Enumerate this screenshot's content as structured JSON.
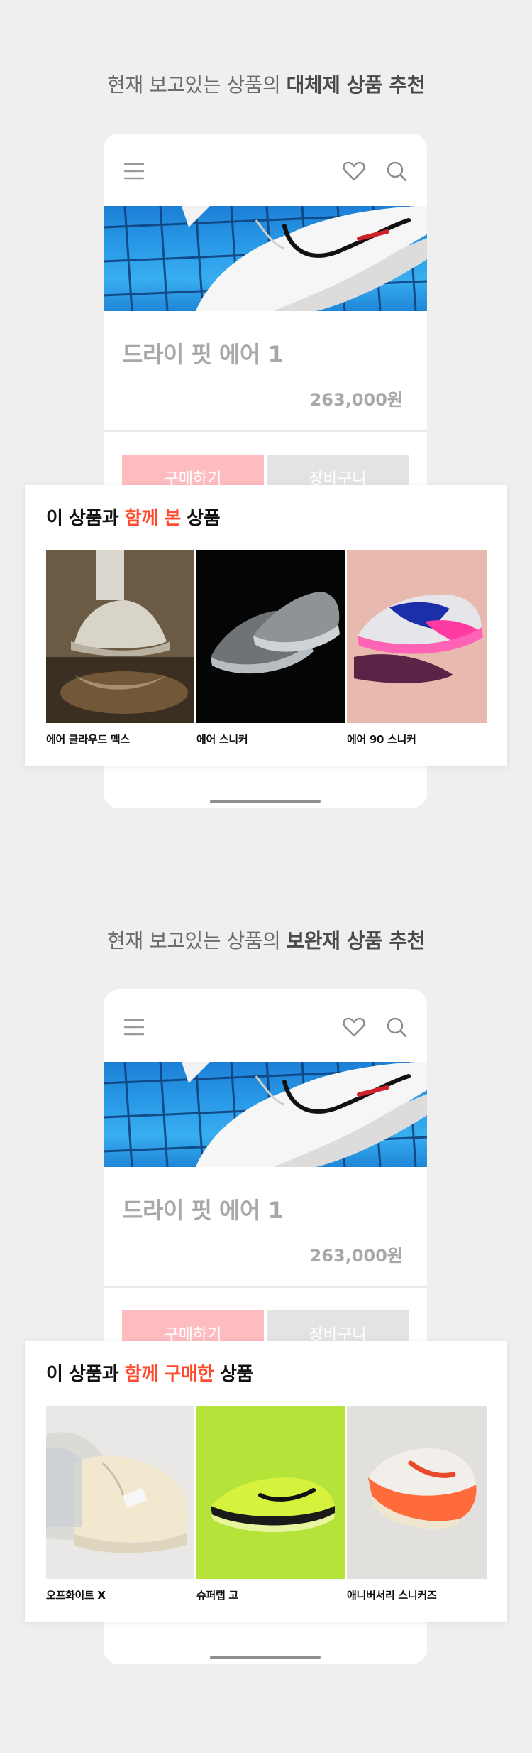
{
  "sections": [
    {
      "heading_prefix": "현재 보고있는 상품의 ",
      "heading_bold": "대체제 상품 추천",
      "product": {
        "name": "드라이 핏 에어 1",
        "price": "263,000원"
      },
      "buttons": {
        "buy": "구매하기",
        "cart": "장바구니"
      },
      "card": {
        "title_prefix": "이 상품과 ",
        "title_accent": "함께 본",
        "title_suffix": " 상품",
        "items": [
          {
            "label": "에어 클라우드 맥스"
          },
          {
            "label": "에어 스니커"
          },
          {
            "label": "에어 90 스니커"
          }
        ]
      }
    },
    {
      "heading_prefix": "현재 보고있는 상품의 ",
      "heading_bold": "보완재 상품 추천",
      "product": {
        "name": "드라이 핏 에어 1",
        "price": "263,000원"
      },
      "buttons": {
        "buy": "구매하기",
        "cart": "장바구니"
      },
      "card": {
        "title_prefix": "이 상품과 ",
        "title_accent": "함께 구매한",
        "title_suffix": " 상품",
        "items": [
          {
            "label": "오프화이트 X"
          },
          {
            "label": "슈퍼랩 고"
          },
          {
            "label": "애니버서리 스니커즈"
          }
        ]
      }
    }
  ],
  "icons": {
    "menu": "menu-icon",
    "wishlist": "heart-icon",
    "search": "search-icon"
  },
  "colors": {
    "accent": "#ff4a2e",
    "buy_button": "#ffbcc0",
    "cart_button": "#e3e3e3"
  }
}
